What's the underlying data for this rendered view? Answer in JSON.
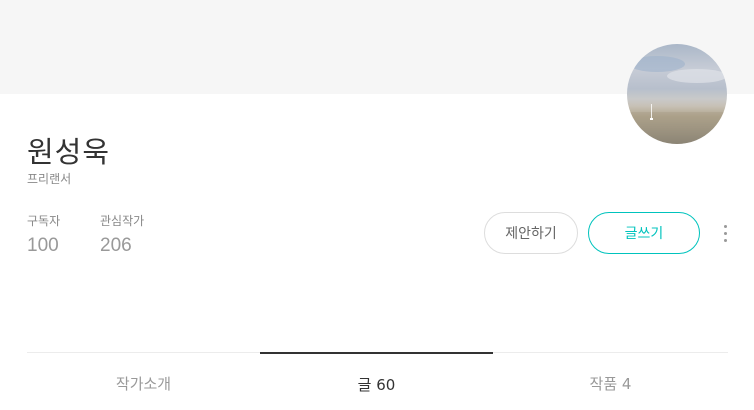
{
  "profile": {
    "name": "원성욱",
    "job": "프리랜서",
    "avatar_icon": "avatar-photo"
  },
  "stats": {
    "subscribers_label": "구독자",
    "subscribers_value": "100",
    "watching_label": "관심작가",
    "watching_value": "206"
  },
  "actions": {
    "suggest_label": "제안하기",
    "write_label": "글쓰기",
    "more_icon": "more-vertical-icon"
  },
  "colors": {
    "accent": "#00c3bd",
    "cover_bg": "#f6f6f6"
  },
  "tabs": [
    {
      "label": "작가소개"
    },
    {
      "label": "글 60"
    },
    {
      "label": "작품 4"
    }
  ]
}
